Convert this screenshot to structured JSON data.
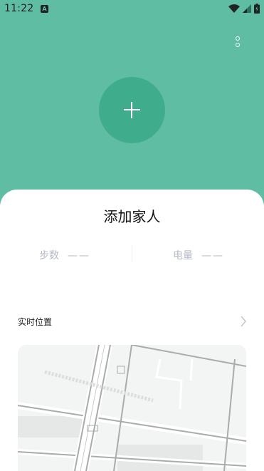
{
  "status_bar": {
    "time": "11:22",
    "notif_badge": "A"
  },
  "header": {
    "more_icon": "more-vertical-icon",
    "add_icon": "plus-icon"
  },
  "card": {
    "title": "添加家人",
    "steps": {
      "label": "步数",
      "value": "——"
    },
    "battery": {
      "label": "电量",
      "value": "——"
    },
    "location": {
      "label": "实时位置",
      "chevron": "chevron-right-icon"
    }
  },
  "colors": {
    "header_bg": "#5fbda4",
    "add_button": "#3fad8c",
    "card_bg": "#ffffff",
    "muted_text": "#b5b9c4"
  }
}
